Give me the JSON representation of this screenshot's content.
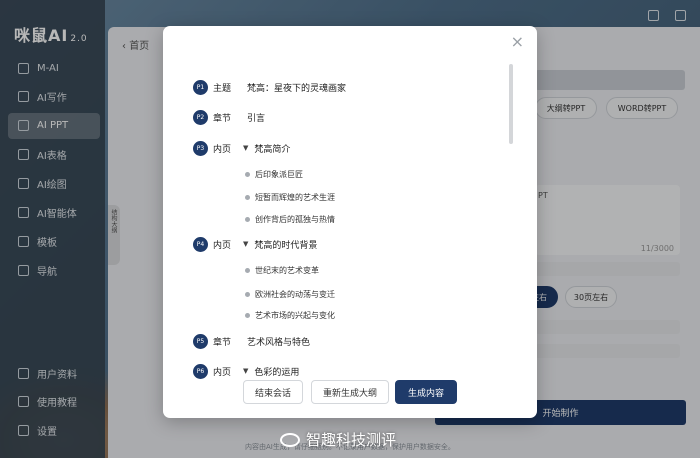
{
  "app": {
    "logo_text": "咪鼠AI",
    "logo_version": "2.0"
  },
  "sidebar": {
    "items": [
      {
        "label": "M-AI",
        "icon": "m-ai-icon"
      },
      {
        "label": "AI写作",
        "icon": "write-icon"
      },
      {
        "label": "AI PPT",
        "icon": "ppt-icon",
        "active": true
      },
      {
        "label": "AI表格",
        "icon": "table-icon"
      },
      {
        "label": "AI绘图",
        "icon": "draw-icon"
      },
      {
        "label": "AI智能体",
        "icon": "agent-icon"
      },
      {
        "label": "模板",
        "icon": "template-icon"
      },
      {
        "label": "导航",
        "icon": "nav-icon"
      }
    ],
    "bottom_items": [
      {
        "label": "用户资料",
        "icon": "user-icon"
      },
      {
        "label": "使用教程",
        "icon": "tutorial-icon"
      },
      {
        "label": "设置",
        "icon": "settings-icon"
      }
    ]
  },
  "main": {
    "breadcrumb": "首页",
    "collapse_tab": "结构大纲",
    "right_buttons": [
      "大纲转PPT",
      "WORD转PPT"
    ],
    "textarea_text": "PT",
    "char_count": "11/3000",
    "page_options": [
      "左右",
      "30页左右"
    ],
    "start_button": "开始制作",
    "footnote": "内容由AI生成，请仔细甄别。不记录用户数据，保护用户数据安全。"
  },
  "modal": {
    "close_symbol": "×",
    "entries": [
      {
        "badge": "P1",
        "kind": "主题",
        "title": "梵高：星夜下的灵魂画家",
        "arrow": false,
        "subs": []
      },
      {
        "badge": "P2",
        "kind": "章节",
        "title": "引言",
        "arrow": false,
        "subs": []
      },
      {
        "badge": "P3",
        "kind": "内页",
        "title": "梵高简介",
        "arrow": true,
        "subs": [
          "后印象派巨匠",
          "短暂而辉煌的艺术生涯",
          "创作背后的孤独与热情"
        ]
      },
      {
        "badge": "P4",
        "kind": "内页",
        "title": "梵高的时代背景",
        "arrow": true,
        "subs": [
          "世纪末的艺术变革",
          "欧洲社会的动荡与变迁",
          "艺术市场的兴起与变化"
        ]
      },
      {
        "badge": "P5",
        "kind": "章节",
        "title": "艺术风格与特色",
        "arrow": false,
        "subs": []
      },
      {
        "badge": "P6",
        "kind": "内页",
        "title": "色彩的运用",
        "arrow": true,
        "subs": []
      }
    ],
    "buttons": {
      "end": "结束会话",
      "regen": "重新生成大纲",
      "generate": "生成内容"
    }
  },
  "watermark": "智趣科技测评",
  "colors": {
    "accent": "#1f3b6a",
    "sidebar_bg": "#374654",
    "overlay": "rgba(0,0,0,0.28)"
  }
}
